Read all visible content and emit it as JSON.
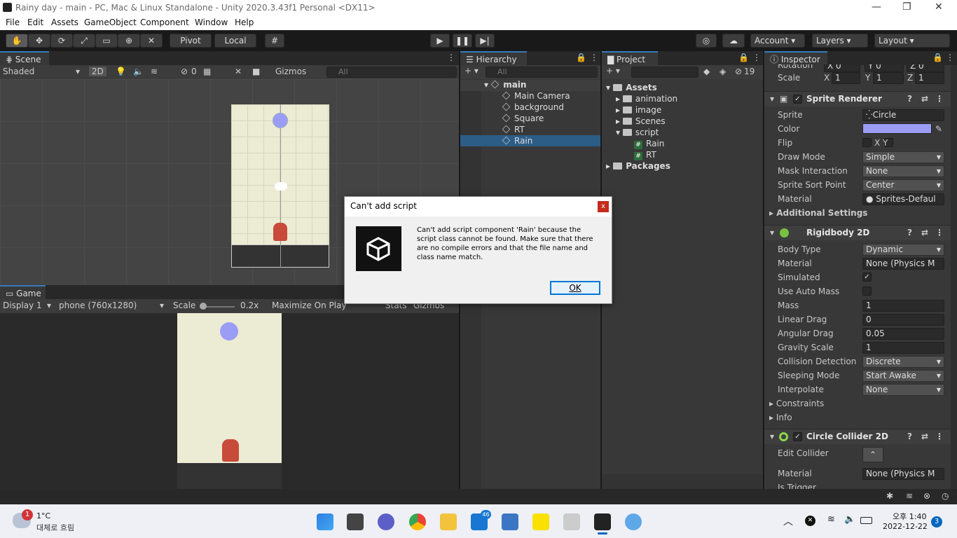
{
  "window": {
    "title": "Rainy day - main - PC, Mac & Linux Standalone - Unity 2020.3.43f1 Personal <DX11>",
    "min": "—",
    "max": "❐",
    "close": "✕"
  },
  "menu": [
    "File",
    "Edit",
    "Assets",
    "GameObject",
    "Component",
    "Window",
    "Help"
  ],
  "toolbar": {
    "pivot": "Pivot",
    "local": "Local",
    "account": "Account",
    "layers": "Layers",
    "layout": "Layout"
  },
  "scene": {
    "tab": "Scene",
    "shading": "Shaded",
    "mode2d": "2D",
    "hidden_count": "0",
    "gizmos": "Gizmos",
    "search": "All"
  },
  "game": {
    "tab": "Game",
    "display": "Display 1",
    "resolution": "phone (760x1280)",
    "scale_label": "Scale",
    "scale_value": "0.2x",
    "maximize": "Maximize On Play",
    "stats": "Stats",
    "gizmos": "Gizmos"
  },
  "hierarchy": {
    "tab": "Hierarchy",
    "search": "All",
    "root": "main",
    "items": [
      "Main Camera",
      "background",
      "Square",
      "RT",
      "Rain"
    ],
    "selected": "Rain"
  },
  "project": {
    "tab": "Project",
    "count": "19",
    "assets": "Assets",
    "folders": [
      "animation",
      "image",
      "Scenes",
      "script"
    ],
    "scripts": [
      "Rain",
      "RT"
    ],
    "packages": "Packages"
  },
  "inspector": {
    "tab": "Inspector",
    "rotation_label": "Rotation",
    "rot": [
      "X 0",
      "Y 0",
      "Z 0"
    ],
    "scale_label": "Scale",
    "scale": [
      "1",
      "1",
      "1"
    ],
    "sprite_renderer": {
      "title": "Sprite Renderer",
      "rows": [
        {
          "label": "Sprite",
          "value": "Circle"
        },
        {
          "label": "Color",
          "value": ""
        },
        {
          "label": "Flip",
          "value": "X   Y"
        },
        {
          "label": "Draw Mode",
          "value": "Simple"
        },
        {
          "label": "Mask Interaction",
          "value": "None"
        },
        {
          "label": "Sprite Sort Point",
          "value": "Center"
        },
        {
          "label": "Material",
          "value": "Sprites-Defaul"
        }
      ],
      "additional": "Additional Settings"
    },
    "rigidbody": {
      "title": "Rigidbody 2D",
      "rows": [
        {
          "label": "Body Type",
          "value": "Dynamic"
        },
        {
          "label": "Material",
          "value": "None (Physics M"
        },
        {
          "label": "Simulated",
          "value": "✓"
        },
        {
          "label": "Use Auto Mass",
          "value": ""
        },
        {
          "label": "Mass",
          "value": "1"
        },
        {
          "label": "Linear Drag",
          "value": "0"
        },
        {
          "label": "Angular Drag",
          "value": "0.05"
        },
        {
          "label": "Gravity Scale",
          "value": "1"
        },
        {
          "label": "Collision Detection",
          "value": "Discrete"
        },
        {
          "label": "Sleeping Mode",
          "value": "Start Awake"
        },
        {
          "label": "Interpolate",
          "value": "None"
        }
      ],
      "constraints": "Constraints",
      "info": "Info"
    },
    "collider": {
      "title": "Circle Collider 2D",
      "edit": "Edit Collider",
      "material_label": "Material",
      "material": "None (Physics M",
      "trigger": "Is Trigger"
    },
    "color_value": "#9b9cf5"
  },
  "dialog": {
    "title": "Can't add script",
    "message": "Can't add script component 'Rain' because the script class cannot be found. Make sure that there are no compile errors and that the file name and class name match.",
    "ok": "OK",
    "close": "x"
  },
  "taskbar": {
    "temp": "1°C",
    "weather": "대체로 흐림",
    "badge": "1",
    "time": "오후 1:40",
    "date": "2022-12-22",
    "notif": "3",
    "app_badge": "46"
  },
  "colors": {
    "accent": "#3a79bb",
    "selection": "#2c5d87"
  }
}
